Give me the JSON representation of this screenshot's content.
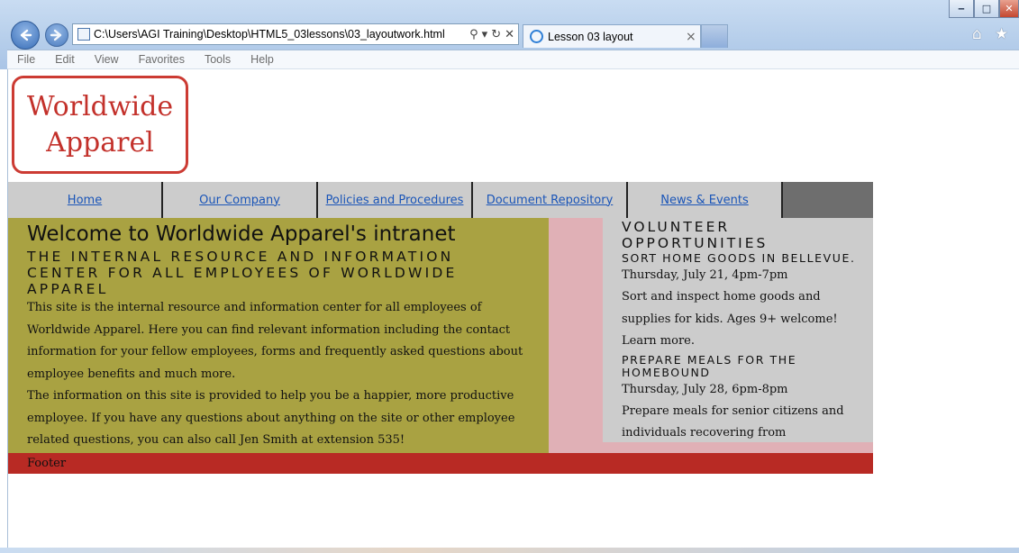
{
  "browser": {
    "address": "C:\\Users\\AGI Training\\Desktop\\HTML5_03lessons\\03_layoutwork.html",
    "tab_title": "Lesson 03 layout",
    "menu": [
      "File",
      "Edit",
      "View",
      "Favorites",
      "Tools",
      "Help"
    ],
    "icons": [
      "back-arrow-icon",
      "forward-arrow-icon",
      "page-icon",
      "search-icon",
      "refresh-icon",
      "stop-icon",
      "ie-icon",
      "home-icon",
      "favorites-star-icon"
    ]
  },
  "page": {
    "logo": {
      "line1": "Worldwide",
      "line2": "Apparel"
    },
    "nav": [
      "Home",
      "Our Company",
      "Policies and Procedures",
      "Document Repository",
      "News & Events"
    ],
    "main": {
      "heading": "Welcome to Worldwide Apparel's intranet",
      "subheading": "The internal resource and information center for all employees of Worldwide Apparel",
      "p1": "This site is the internal resource and information center for all employees of Worldwide Apparel. Here you can find relevant information including the contact information for your fellow employees, forms and frequently asked questions about employee benefits and much more.",
      "p2": "The information on this site is provided to help you be a happier, more productive employee. If you have any questions about anything on the site or other employee related questions, you can also call Jen Smith at extension 535!"
    },
    "aside": {
      "heading": "Volunteer Opportunities",
      "events": [
        {
          "title": "Sort home goods in Bellevue.",
          "date": "Thursday, July 21, 4pm-7pm",
          "desc": "Sort and inspect home goods and supplies for kids. Ages 9+ welcome! Learn more."
        },
        {
          "title": "Prepare meals for the homebound",
          "date": "Thursday, July 28, 6pm-8pm",
          "desc": "Prepare meals for senior citizens and individuals recovering from surgery.Learn more."
        }
      ]
    },
    "footer": "Footer"
  },
  "colors": {
    "logo_red": "#c3312b",
    "nav_bg": "#cccccc",
    "main_bg": "#a9a242",
    "gutter_pink": "#e0b0b6",
    "aside_bg": "#cccccc",
    "footer_red": "#b82a24",
    "link_blue": "#1a55b8"
  }
}
